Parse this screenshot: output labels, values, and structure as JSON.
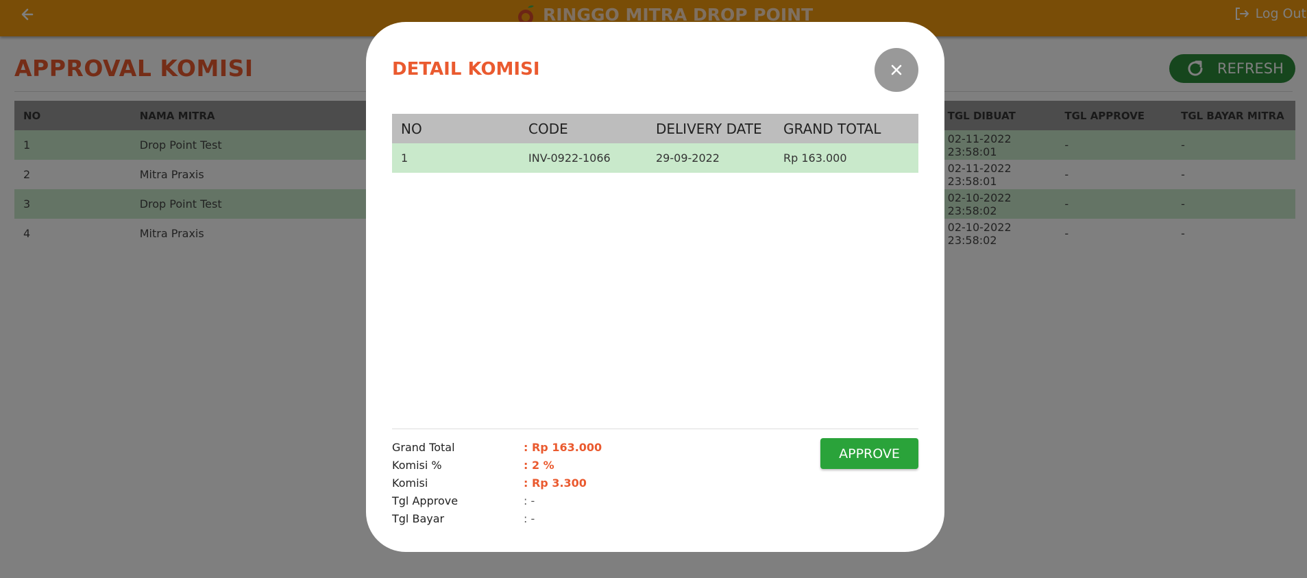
{
  "header": {
    "title": "RINGGO MITRA DROP POINT",
    "logout_label": "Log Out"
  },
  "page": {
    "title": "APPROVAL KOMISI",
    "refresh_label": "REFRESH"
  },
  "main_table": {
    "headers": [
      "NO",
      "NAMA MITRA",
      "TGL DIBUAT",
      "TGL APPROVE",
      "TGL BAYAR MITRA"
    ],
    "rows": [
      {
        "no": "1",
        "mitra": "Drop Point Test",
        "dibuat_date": "02-11-2022",
        "dibuat_time": "23:58:01",
        "approve": "-",
        "bayar": "-"
      },
      {
        "no": "2",
        "mitra": "Mitra Praxis",
        "dibuat_date": "02-11-2022",
        "dibuat_time": "23:58:01",
        "approve": "-",
        "bayar": "-"
      },
      {
        "no": "3",
        "mitra": "Drop Point Test",
        "dibuat_date": "02-10-2022",
        "dibuat_time": "23:58:02",
        "approve": "-",
        "bayar": "-"
      },
      {
        "no": "4",
        "mitra": "Mitra Praxis",
        "dibuat_date": "02-10-2022",
        "dibuat_time": "23:58:02",
        "approve": "-",
        "bayar": "-"
      }
    ]
  },
  "modal": {
    "title": "DETAIL KOMISI",
    "table": {
      "headers": [
        "NO",
        "CODE",
        "DELIVERY DATE",
        "GRAND TOTAL"
      ],
      "rows": [
        {
          "no": "1",
          "code": "INV-0922-1066",
          "delivery_date": "29-09-2022",
          "grand_total": "Rp 163.000"
        }
      ]
    },
    "summary": [
      {
        "label": "Grand Total",
        "value": ": Rp 163.000"
      },
      {
        "label": "Komisi %",
        "value": ": 2 %"
      },
      {
        "label": "Komisi",
        "value": ": Rp 3.300"
      },
      {
        "label": "Tgl Approve",
        "value": ": -"
      },
      {
        "label": "Tgl Bayar",
        "value": ": -"
      }
    ],
    "approve_label": "APPROVE"
  },
  "colors": {
    "topbar": "#f39a0e",
    "accent": "#ea5a2f",
    "approve": "#2aa33a",
    "refresh": "#2c8d3a",
    "row_highlight": "#c9e9cb"
  }
}
